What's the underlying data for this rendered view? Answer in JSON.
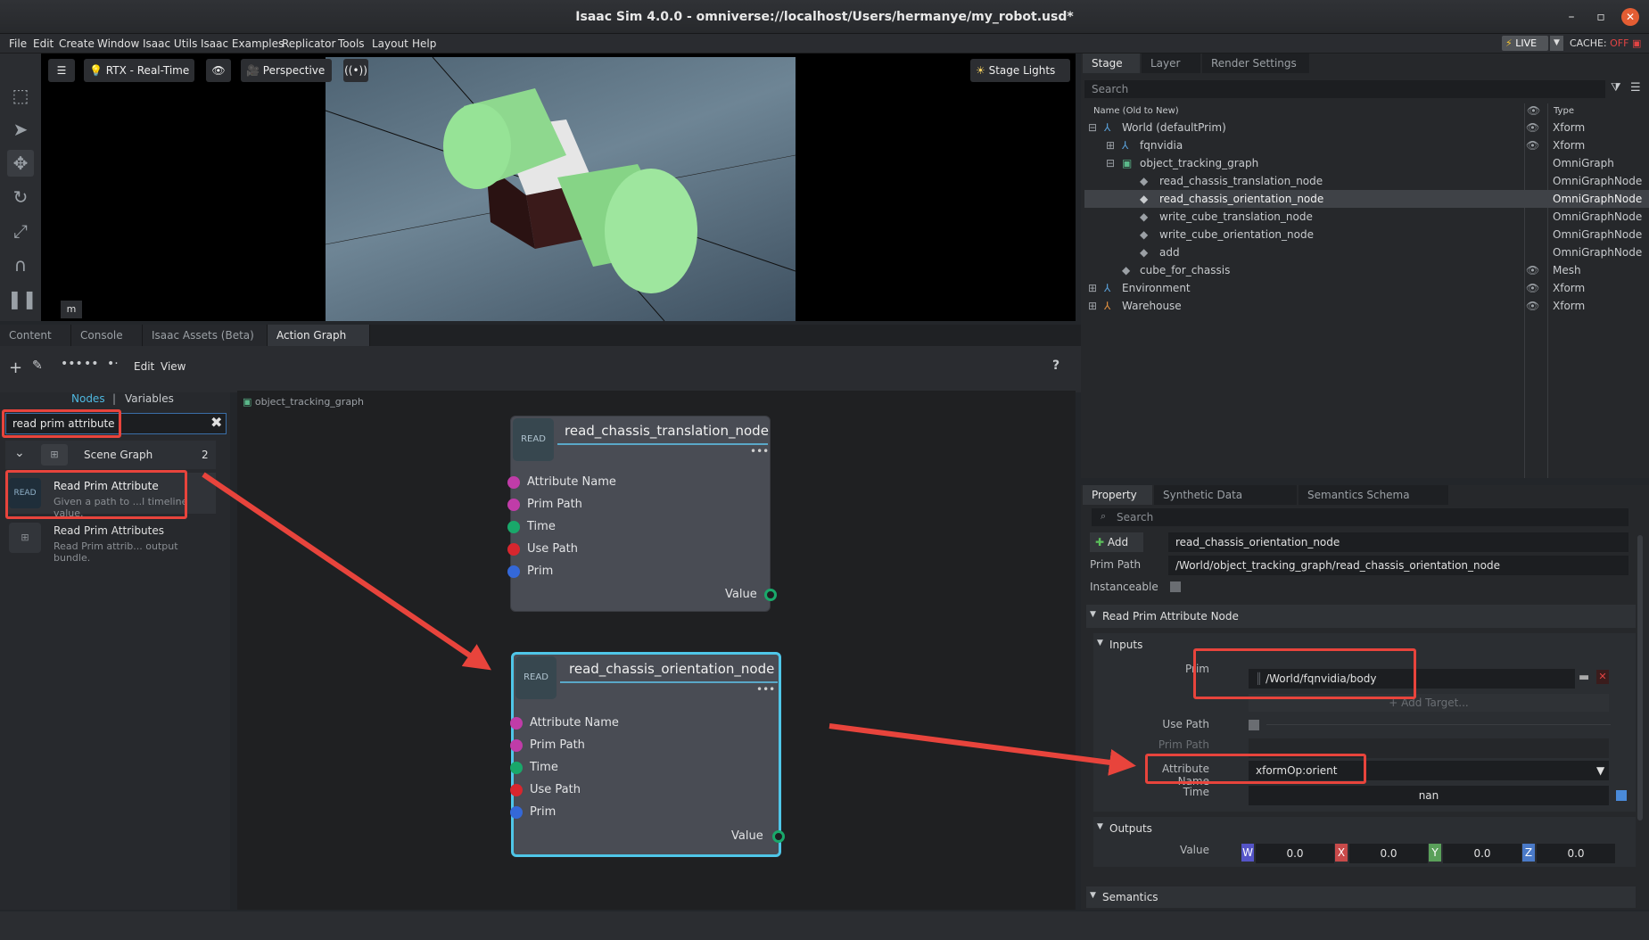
{
  "window": {
    "title": "Isaac Sim 4.0.0 - omniverse://localhost/Users/hermanye/my_robot.usd*",
    "min": "–",
    "max": "▫",
    "close": "✕"
  },
  "menu": [
    "File",
    "Edit",
    "Create",
    "Window",
    "Isaac Utils",
    "Isaac Examples",
    "Replicator",
    "Tools",
    "Layout",
    "Help"
  ],
  "live": {
    "label": "LIVE",
    "cache_label": "CACHE:",
    "cache_state": "OFF"
  },
  "viewport": {
    "renderer": "RTX - Real-Time",
    "camera": "Perspective",
    "lights": "Stage Lights",
    "m_badge": "m"
  },
  "bottom_tabs": [
    "Content",
    "Console",
    "Isaac Assets (Beta)",
    "Action Graph"
  ],
  "graph_toolbar": {
    "edit": "Edit",
    "view": "View",
    "help": "?"
  },
  "node_library": {
    "tabs": [
      "Nodes",
      "Variables"
    ],
    "search_value": "read prim attribute",
    "category": {
      "name": "Scene Graph",
      "count": "2"
    },
    "items": [
      {
        "title": "Read Prim Attribute",
        "desc": "Given a path to ...l timeline value.",
        "badge": "READ"
      },
      {
        "title": "Read Prim Attributes",
        "desc": "Read Prim attrib... output bundle."
      }
    ]
  },
  "graph": {
    "breadcrumb": "object_tracking_graph",
    "nodes": [
      {
        "title": "read_chassis_translation_node",
        "badge": "READ",
        "ports": [
          "Attribute Name",
          "Prim Path",
          "Time",
          "Use Path",
          "Prim"
        ],
        "output": "Value"
      },
      {
        "title": "read_chassis_orientation_node",
        "badge": "READ",
        "ports": [
          "Attribute Name",
          "Prim Path",
          "Time",
          "Use Path",
          "Prim"
        ],
        "output": "Value"
      }
    ]
  },
  "stage": {
    "tabs": [
      "Stage",
      "Layer",
      "Render Settings"
    ],
    "search_placeholder": "Search",
    "col_name": "Name (Old to New)",
    "col_type": "Type",
    "rows": [
      {
        "name": "World (defaultPrim)",
        "type": "Xform"
      },
      {
        "name": "fqnvidia",
        "type": "Xform"
      },
      {
        "name": "object_tracking_graph",
        "type": "OmniGraph"
      },
      {
        "name": "read_chassis_translation_node",
        "type": "OmniGraphNode"
      },
      {
        "name": "read_chassis_orientation_node",
        "type": "OmniGraphNode"
      },
      {
        "name": "write_cube_translation_node",
        "type": "OmniGraphNode"
      },
      {
        "name": "write_cube_orientation_node",
        "type": "OmniGraphNode"
      },
      {
        "name": "add",
        "type": "OmniGraphNode"
      },
      {
        "name": "cube_for_chassis",
        "type": "Mesh"
      },
      {
        "name": "Environment",
        "type": "Xform"
      },
      {
        "name": "Warehouse",
        "type": "Xform"
      }
    ]
  },
  "property": {
    "tabs": [
      "Property",
      "Synthetic Data Recorder",
      "Semantics Schema Editor"
    ],
    "search_placeholder": "Search",
    "add_label": "Add",
    "name_value": "read_chassis_orientation_node",
    "prim_path_label": "Prim Path",
    "prim_path_value": "/World/object_tracking_graph/read_chassis_orientation_node",
    "instanceable_label": "Instanceable",
    "section": "Read Prim Attribute Node",
    "inputs_label": "Inputs",
    "prim_label": "Prim",
    "prim_value": "/World/fqnvidia/body",
    "add_target": "Add Target...",
    "use_path_label": "Use Path",
    "prim_path2_label": "Prim Path",
    "attr_name_label": "Attribute Name",
    "attr_name_value": "xformOp:orient",
    "time_label": "Time",
    "time_value": "nan",
    "outputs_label": "Outputs",
    "value_label": "Value",
    "value_components": [
      {
        "axis": "W",
        "value": "0.0",
        "color": "#5555c8"
      },
      {
        "axis": "X",
        "value": "0.0",
        "color": "#c84a4a"
      },
      {
        "axis": "Y",
        "value": "0.0",
        "color": "#5aa05a"
      },
      {
        "axis": "Z",
        "value": "0.0",
        "color": "#4a7ac8"
      }
    ],
    "semantics_label": "Semantics"
  },
  "colors": {
    "accent_blue": "#4fb8e0",
    "annotation_red": "#e8443c",
    "green_port": "#19a86a"
  }
}
